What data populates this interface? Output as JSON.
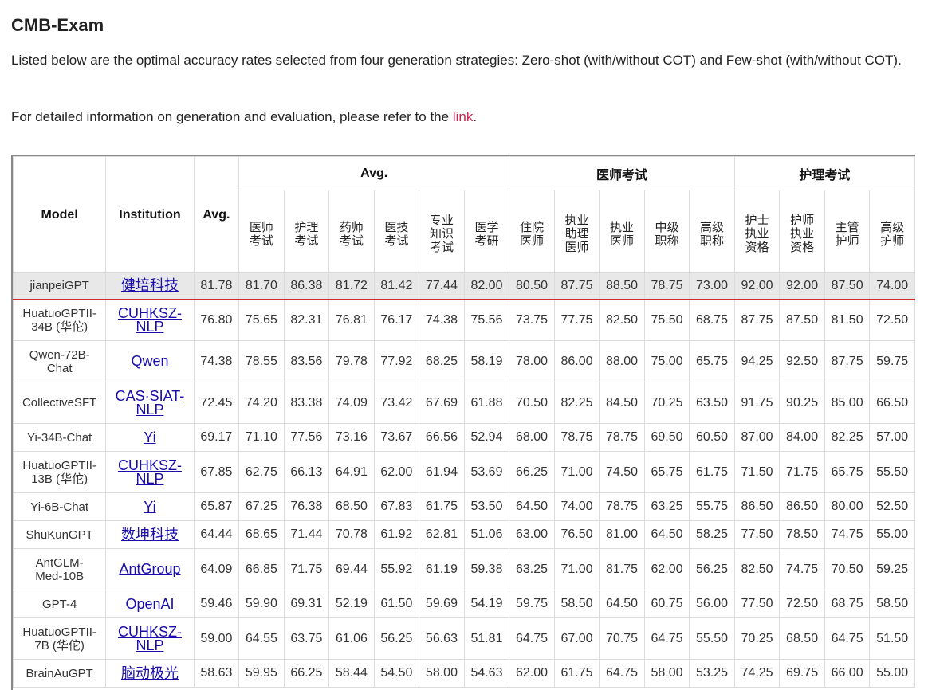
{
  "page": {
    "title": "CMB-Exam",
    "description": "Listed below are the optimal accuracy rates selected from four generation strategies: Zero-shot (with/without COT) and Few-shot (with/without COT).",
    "detail_prefix": "For detailed information on generation and evaluation, please refer to the ",
    "detail_link": "link",
    "detail_suffix": "."
  },
  "table": {
    "headers": {
      "model": "Model",
      "institution": "Institution",
      "avg": "Avg.",
      "groups": [
        "Avg.",
        "医师考试",
        "护理考试"
      ],
      "sub": [
        [
          "医师",
          "考试"
        ],
        [
          "护理",
          "考试"
        ],
        [
          "药师",
          "考试"
        ],
        [
          "医技",
          "考试"
        ],
        [
          "专业",
          "知识",
          "考试"
        ],
        [
          "医学",
          "考研"
        ],
        [
          "住院",
          "医师"
        ],
        [
          "执业",
          "助理",
          "医师"
        ],
        [
          "执业",
          "医师"
        ],
        [
          "中级",
          "职称"
        ],
        [
          "高级",
          "职称"
        ],
        [
          "护士",
          "执业",
          "资格"
        ],
        [
          "护师",
          "执业",
          "资格"
        ],
        [
          "主管",
          "护师"
        ],
        [
          "高级",
          "护师"
        ]
      ]
    },
    "rows": [
      {
        "model": [
          "jianpeiGPT"
        ],
        "inst": [
          "健培科技"
        ],
        "avg": "81.78",
        "vals": [
          "81.70",
          "86.38",
          "81.72",
          "81.42",
          "77.44",
          "82.00",
          "80.50",
          "87.75",
          "88.50",
          "78.75",
          "73.00",
          "92.00",
          "92.00",
          "87.50",
          "74.00"
        ]
      },
      {
        "model": [
          "HuatuoGPTII-",
          "34B (华佗)"
        ],
        "inst": [
          "CUHKSZ-",
          "NLP"
        ],
        "avg": "76.80",
        "vals": [
          "75.65",
          "82.31",
          "76.81",
          "76.17",
          "74.38",
          "75.56",
          "73.75",
          "77.75",
          "82.50",
          "75.50",
          "68.75",
          "87.75",
          "87.50",
          "81.50",
          "72.50"
        ]
      },
      {
        "model": [
          "Qwen-72B-",
          "Chat"
        ],
        "inst": [
          "Qwen"
        ],
        "avg": "74.38",
        "vals": [
          "78.55",
          "83.56",
          "79.78",
          "77.92",
          "68.25",
          "58.19",
          "78.00",
          "86.00",
          "88.00",
          "75.00",
          "65.75",
          "94.25",
          "92.50",
          "87.75",
          "59.75"
        ]
      },
      {
        "model": [
          "CollectiveSFT"
        ],
        "inst": [
          "CAS·SIAT-",
          "NLP"
        ],
        "avg": "72.45",
        "vals": [
          "74.20",
          "83.38",
          "74.09",
          "73.42",
          "67.69",
          "61.88",
          "70.50",
          "82.25",
          "84.50",
          "70.25",
          "63.50",
          "91.75",
          "90.25",
          "85.00",
          "66.50"
        ]
      },
      {
        "model": [
          "Yi-34B-Chat"
        ],
        "inst": [
          "Yi"
        ],
        "avg": "69.17",
        "vals": [
          "71.10",
          "77.56",
          "73.16",
          "73.67",
          "66.56",
          "52.94",
          "68.00",
          "78.75",
          "78.75",
          "69.50",
          "60.50",
          "87.00",
          "84.00",
          "82.25",
          "57.00"
        ]
      },
      {
        "model": [
          "HuatuoGPTII-",
          "13B (华佗)"
        ],
        "inst": [
          "CUHKSZ-",
          "NLP"
        ],
        "avg": "67.85",
        "vals": [
          "62.75",
          "66.13",
          "64.91",
          "62.00",
          "61.94",
          "53.69",
          "66.25",
          "71.00",
          "74.50",
          "65.75",
          "61.75",
          "71.50",
          "71.75",
          "65.75",
          "55.50"
        ]
      },
      {
        "model": [
          "Yi-6B-Chat"
        ],
        "inst": [
          "Yi"
        ],
        "avg": "65.87",
        "vals": [
          "67.25",
          "76.38",
          "68.50",
          "67.83",
          "61.75",
          "53.50",
          "64.50",
          "74.00",
          "78.75",
          "63.25",
          "55.75",
          "86.50",
          "86.50",
          "80.00",
          "52.50"
        ]
      },
      {
        "model": [
          "ShuKunGPT"
        ],
        "inst": [
          "数坤科技"
        ],
        "avg": "64.44",
        "vals": [
          "68.65",
          "71.44",
          "70.78",
          "61.92",
          "62.81",
          "51.06",
          "63.00",
          "76.50",
          "81.00",
          "64.50",
          "58.25",
          "77.50",
          "78.50",
          "74.75",
          "55.00"
        ]
      },
      {
        "model": [
          "AntGLM-",
          "Med-10B"
        ],
        "inst": [
          "AntGroup"
        ],
        "avg": "64.09",
        "vals": [
          "66.85",
          "71.75",
          "69.44",
          "55.92",
          "61.19",
          "59.38",
          "63.25",
          "71.00",
          "81.75",
          "62.00",
          "56.25",
          "82.50",
          "74.75",
          "70.50",
          "59.25"
        ]
      },
      {
        "model": [
          "GPT-4"
        ],
        "inst": [
          "OpenAI"
        ],
        "avg": "59.46",
        "vals": [
          "59.90",
          "69.31",
          "52.19",
          "61.50",
          "59.69",
          "54.19",
          "59.75",
          "58.50",
          "64.50",
          "60.75",
          "56.00",
          "77.50",
          "72.50",
          "68.75",
          "58.50"
        ]
      },
      {
        "model": [
          "HuatuoGPTII-",
          "7B (华佗)"
        ],
        "inst": [
          "CUHKSZ-",
          "NLP"
        ],
        "avg": "59.00",
        "vals": [
          "64.55",
          "63.75",
          "61.06",
          "56.25",
          "56.63",
          "51.81",
          "64.75",
          "67.00",
          "70.75",
          "64.75",
          "55.50",
          "70.25",
          "68.50",
          "64.75",
          "51.50"
        ]
      },
      {
        "model": [
          "BrainAuGPT"
        ],
        "inst": [
          "脑动极光"
        ],
        "avg": "58.63",
        "vals": [
          "59.95",
          "66.25",
          "58.44",
          "54.50",
          "58.00",
          "54.63",
          "62.00",
          "61.75",
          "64.75",
          "58.00",
          "53.25",
          "74.25",
          "69.75",
          "66.00",
          "55.00"
        ]
      }
    ]
  }
}
